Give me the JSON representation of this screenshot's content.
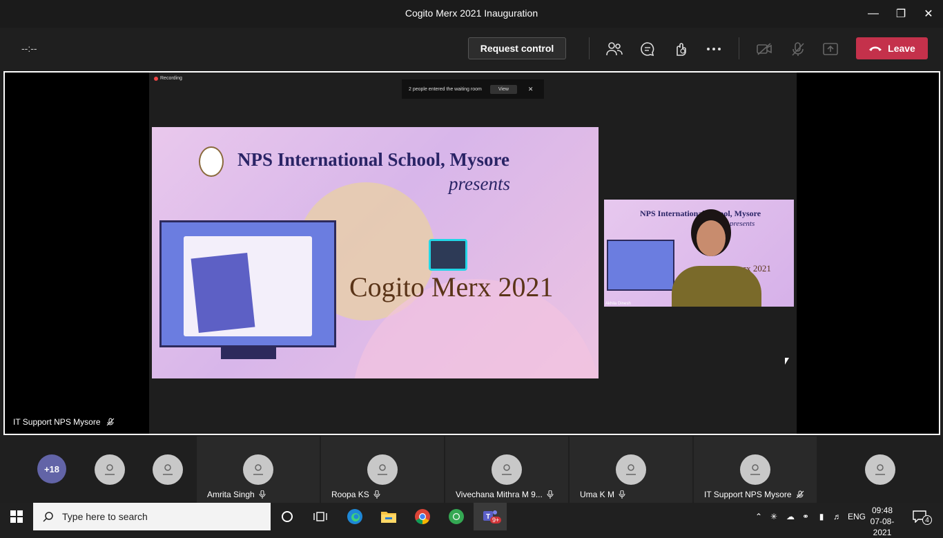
{
  "window": {
    "title": "Cogito Merx 2021 Inauguration"
  },
  "toolbar": {
    "timer": "--:--",
    "request_control": "Request control",
    "leave": "Leave",
    "leave_color": "#c4314b"
  },
  "share": {
    "recording": "Recording",
    "waiting_text": "2 people entered the waiting room",
    "waiting_view": "View",
    "waiting_close": "✕",
    "slide": {
      "line1": "NPS International School, Mysore",
      "line2": "presents",
      "line3": "Cogito Merx 2021"
    },
    "pip": {
      "line1": "NPS International School, Mysore",
      "line2": "presents",
      "line3": "erx 2021",
      "name": "Akhila Dinesh"
    }
  },
  "stage_presenter": "IT Support NPS Mysore",
  "participants": {
    "overflow": "+18",
    "tiles": [
      {
        "name": "Amrita Singh"
      },
      {
        "name": "Roopa KS"
      },
      {
        "name": "Vivechana Mithra M 9..."
      },
      {
        "name": "Uma K M"
      },
      {
        "name": "IT Support NPS Mysore"
      }
    ]
  },
  "taskbar": {
    "search_placeholder": "Type here to search",
    "language": "ENG",
    "time": "09:48",
    "date": "07-08-2021",
    "teams_badge": "9+",
    "notifications": "4"
  }
}
